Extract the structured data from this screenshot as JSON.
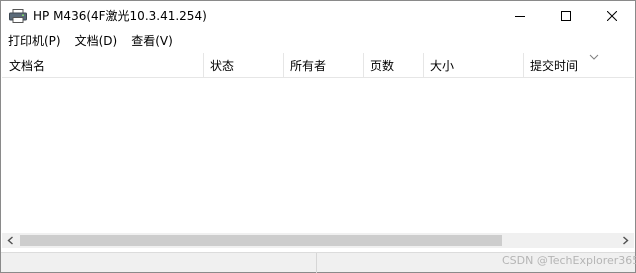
{
  "window": {
    "title": "HP M436(4F激光10.3.41.254)",
    "app_icon": "printer-icon"
  },
  "menu": {
    "items": [
      {
        "label": "打印机(P)"
      },
      {
        "label": "文档(D)"
      },
      {
        "label": "查看(V)"
      }
    ]
  },
  "list": {
    "columns": [
      {
        "label": "文档名"
      },
      {
        "label": "状态"
      },
      {
        "label": "所有者"
      },
      {
        "label": "页数"
      },
      {
        "label": "大小"
      },
      {
        "label": "提交时间"
      }
    ],
    "rows": []
  },
  "watermark": {
    "text": "CSDN @TechExplorer365"
  },
  "colors": {
    "window_border": "#8a8a8a",
    "scrollbar_track": "#f0f0f0",
    "scrollbar_thumb": "#cdcdcd",
    "status_bar": "#f0f0f0"
  }
}
